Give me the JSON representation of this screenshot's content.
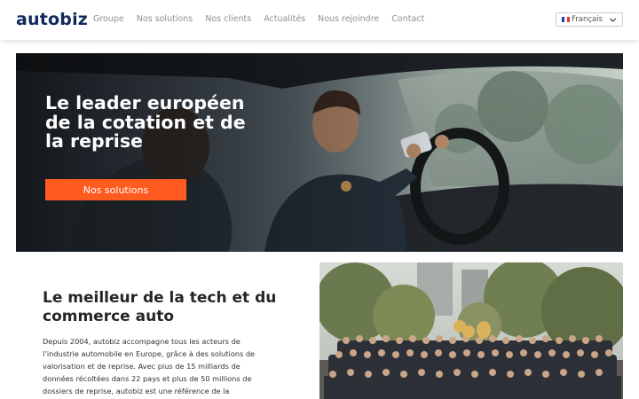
{
  "header": {
    "logo": "autobiz",
    "nav": [
      "Groupe",
      "Nos solutions",
      "Nos clients",
      "Actualités",
      "Nous rejoindre",
      "Contact"
    ],
    "language": "Français"
  },
  "hero": {
    "title": "Le leader européen de la cotation et de la reprise",
    "button_label": "Nos solutions"
  },
  "section": {
    "title": "Le meilleur de la tech et du commerce auto",
    "text": "Depuis 2004, autobiz accompagne tous les acteurs de l’industrie automobile en Europe, grâce à des solutions de valorisation et de reprise. Avec plus de 15 milliards de données récoltées dans 22 pays et plus de 50 millions de dossiers de reprise, autobiz est une référence de la"
  },
  "colors": {
    "brand": "#0f2a5a",
    "accent": "#ff5a1f",
    "nav_text": "#8a8f98"
  }
}
